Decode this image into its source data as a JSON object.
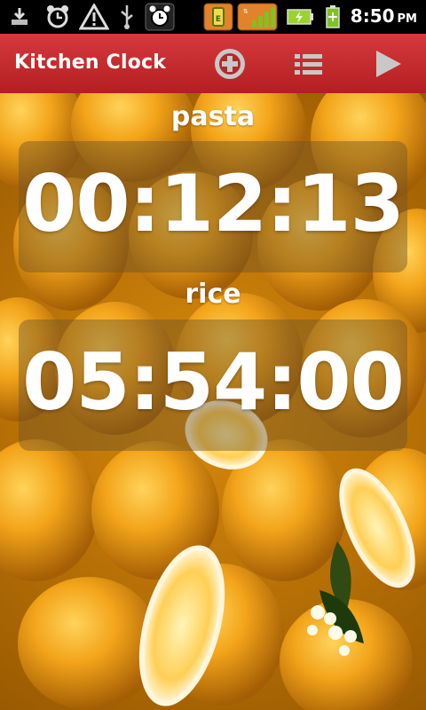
{
  "status_bar": {
    "time": "8:50",
    "ampm": "PM",
    "icons": [
      "download-icon",
      "alarm-icon",
      "warning-icon",
      "usb-icon",
      "alarm-clock-icon",
      "app-notification-icon",
      "signal-icon",
      "battery-charging-icon",
      "battery-icon"
    ]
  },
  "action_bar": {
    "title": "Kitchen Clock",
    "buttons": [
      "add-timer",
      "list",
      "play"
    ]
  },
  "timers": [
    {
      "label": "pasta",
      "time": "00:12:13"
    },
    {
      "label": "rice",
      "time": "05:54:00"
    }
  ],
  "colors": {
    "action_bar": "#c62a2d",
    "status_bar": "#000000",
    "text": "#ffffff"
  }
}
